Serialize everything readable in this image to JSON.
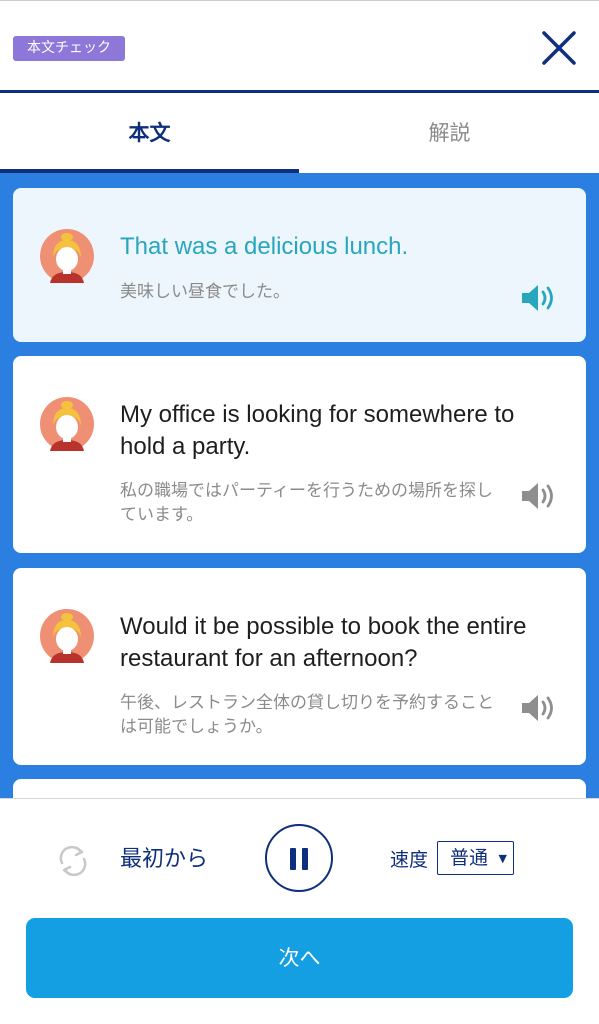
{
  "header": {
    "badge_label": "本文チェック",
    "close_icon": "close-icon"
  },
  "tabs": [
    {
      "label": "本文",
      "selected": true
    },
    {
      "label": "解説",
      "selected": false
    }
  ],
  "dialogue": [
    {
      "english": "That was a delicious lunch.",
      "japanese": "美味しい昼食でした。",
      "active": true,
      "speaker_icon": "speaker-icon"
    },
    {
      "english": "My office is looking for somewhere to hold a party.",
      "japanese": "私の職場ではパーティーを行うための場所を探しています。",
      "active": false,
      "speaker_icon": "speaker-icon"
    },
    {
      "english": "Would it be possible to book the entire restaurant for an afternoon?",
      "japanese": "午後、レストラン全体の貸し切りを予約することは可能でしょうか。",
      "active": false,
      "speaker_icon": "speaker-icon"
    }
  ],
  "controls": {
    "restart_label": "最初から",
    "replay_icon": "replay-icon",
    "pause_icon": "pause-icon",
    "speed_label": "速度",
    "speed_value": "普通",
    "next_label": "次へ"
  },
  "colors": {
    "navy": "#0f2f7c",
    "content_blue": "#2b7fe0",
    "active_text": "#28a6bd",
    "badge_purple": "#8d77d8",
    "next_button": "#139fe2"
  }
}
